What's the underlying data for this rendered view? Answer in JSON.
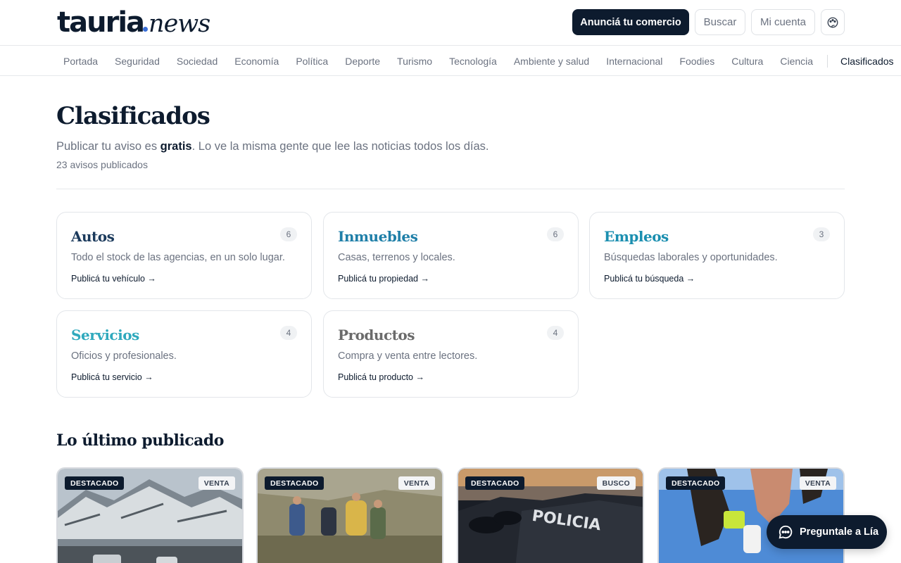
{
  "header": {
    "logo_main": "tauria",
    "logo_suffix": "news",
    "advertise_label": "Anunciá tu comercio",
    "search_label": "Buscar",
    "account_label": "Mi cuenta",
    "theme_icon": "palette-icon"
  },
  "nav": {
    "items": [
      "Portada",
      "Seguridad",
      "Sociedad",
      "Economía",
      "Política",
      "Deporte",
      "Turismo",
      "Tecnología",
      "Ambiente y salud",
      "Internacional",
      "Foodies",
      "Cultura",
      "Ciencia"
    ],
    "active": "Clasificados"
  },
  "page": {
    "title": "Clasificados",
    "subtitle_pre": "Publicar tu aviso es ",
    "subtitle_bold": "gratis",
    "subtitle_post": ". Lo ve la misma gente que lee las noticias todos los días.",
    "count_text": "23 avisos publicados"
  },
  "categories": [
    {
      "title": "Autos",
      "count": "6",
      "description": "Todo el stock de las agencias, en un solo lugar.",
      "cta": "Publicá tu vehículo →",
      "color": "#1b3a5c"
    },
    {
      "title": "Inmuebles",
      "count": "6",
      "description": "Casas, terrenos y locales.",
      "cta": "Publicá tu propiedad →",
      "color": "#1f7fa8"
    },
    {
      "title": "Empleos",
      "count": "3",
      "description": "Búsquedas laborales y oportunidades.",
      "cta": "Publicá tu búsqueda →",
      "color": "#1b8fb0"
    },
    {
      "title": "Servicios",
      "count": "4",
      "description": "Oficios y profesionales.",
      "cta": "Publicá tu servicio →",
      "color": "#2fa9bd"
    },
    {
      "title": "Productos",
      "count": "4",
      "description": "Compra y venta entre lectores.",
      "cta": "Publicá tu producto →",
      "color": "#6b6b6b"
    }
  ],
  "latest": {
    "title": "Lo último publicado",
    "listings": [
      {
        "featured": "DESTACADO",
        "type": "VENTA",
        "thumb": "snowy-mountain-road"
      },
      {
        "featured": "DESTACADO",
        "type": "VENTA",
        "thumb": "hikers-trail"
      },
      {
        "featured": "DESTACADO",
        "type": "BUSCO",
        "thumb": "police-cars"
      },
      {
        "featured": "DESTACADO",
        "type": "VENTA",
        "thumb": "runners-legs"
      }
    ]
  },
  "chat": {
    "label": "Preguntale a Lía",
    "icon": "chat-bubble-icon"
  }
}
